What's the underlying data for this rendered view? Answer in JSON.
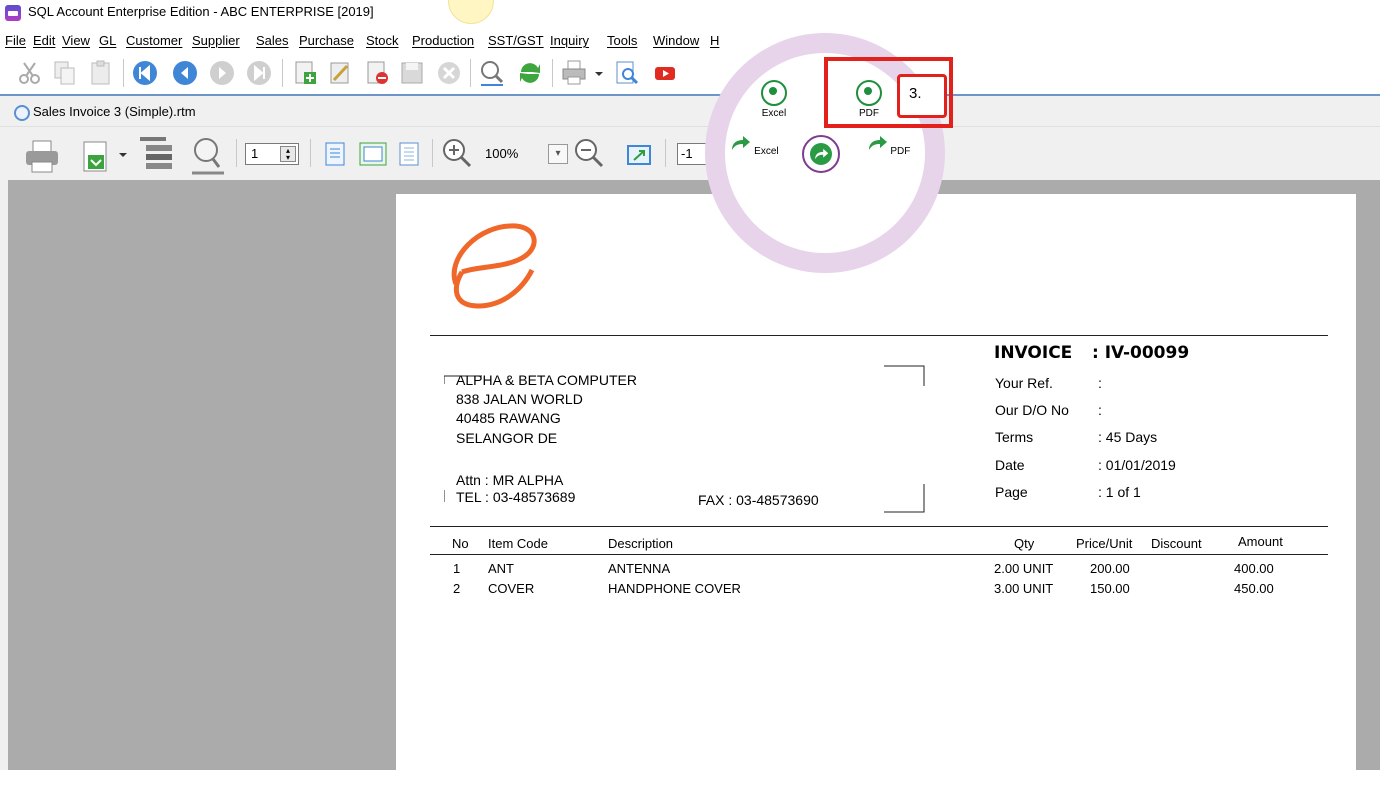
{
  "window": {
    "title": "SQL Account Enterprise Edition - ABC ENTERPRISE [2019]"
  },
  "menu": [
    "File",
    "Edit",
    "View",
    "GL",
    "Customer",
    "Supplier",
    "Sales",
    "Purchase",
    "Stock",
    "Production",
    "SST/GST",
    "Inquiry",
    "Tools",
    "Window",
    "H"
  ],
  "document": {
    "tab_title": "Sales Invoice 3 (Simple).rtm"
  },
  "preview_toolbar": {
    "page_number": "1",
    "zoom": "100%",
    "page_field": "-1"
  },
  "share_popup": {
    "whatsapp_excel": "Excel",
    "whatsapp_pdf": "PDF",
    "export_excel": "Excel",
    "export_pdf": "PDF",
    "callout": "3."
  },
  "invoice": {
    "title": "INVOICE",
    "number": ": IV-00099",
    "customer": {
      "name": "ALPHA & BETA COMPUTER",
      "address1": "838 JALAN WORLD",
      "address2": "40485 RAWANG",
      "address3": "SELANGOR DE",
      "attn": "Attn : MR ALPHA",
      "tel": "TEL : 03-48573689",
      "fax": "FAX : 03-48573690"
    },
    "info": [
      {
        "label": "Your Ref.",
        "value": ":"
      },
      {
        "label": "Our D/O No",
        "value": ":"
      },
      {
        "label": "Terms",
        "value": ": 45 Days"
      },
      {
        "label": "Date",
        "value": ": 01/01/2019"
      },
      {
        "label": "Page",
        "value": ": 1 of 1"
      }
    ],
    "columns": {
      "no": "No",
      "code": "Item Code",
      "desc": "Description",
      "qty": "Qty",
      "price": "Price/Unit",
      "discount": "Discount",
      "amount": "Amount"
    },
    "rows": [
      {
        "no": "1",
        "code": "ANT",
        "desc": "ANTENNA",
        "qty": "2.00 UNIT",
        "price": "200.00",
        "discount": "",
        "amount": "400.00"
      },
      {
        "no": "2",
        "code": "COVER",
        "desc": "HANDPHONE COVER",
        "qty": "3.00 UNIT",
        "price": "150.00",
        "discount": "",
        "amount": "450.00"
      }
    ]
  },
  "colors": {
    "accent_red": "#e2211c",
    "whatsapp_green": "#1e8f3c",
    "popup_ring": "#e7d4eb",
    "logo_orange": "#f0672a"
  }
}
